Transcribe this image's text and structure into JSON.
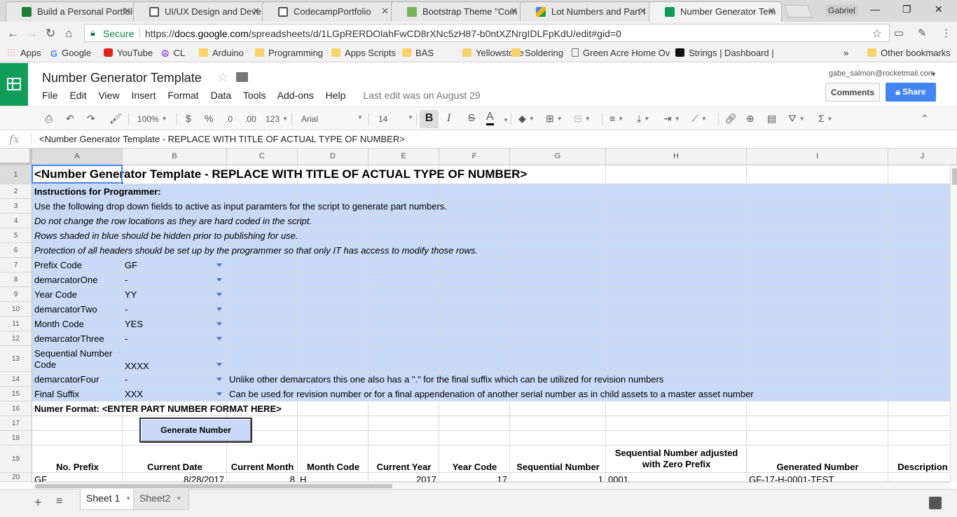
{
  "browser": {
    "tabs": [
      {
        "label": "Build a Personal Portfoli",
        "color": "#1e7e34",
        "active": false
      },
      {
        "label": "UI/UX Design and Deve",
        "color": "#555555",
        "active": false
      },
      {
        "label": "CodecampPortfolio",
        "color": "#555555",
        "active": false
      },
      {
        "label": "Bootstrap Theme \"Com",
        "color": "#76b55b",
        "active": false
      },
      {
        "label": "Lot Numbers and Part I",
        "color": "#f4b400",
        "active": false
      },
      {
        "label": "Number Generator Tem",
        "color": "#0f9d58",
        "active": true
      }
    ],
    "profile": "Gabriel",
    "secure_label": "Secure",
    "url_scheme": "https://",
    "url_host": "docs.google.com",
    "url_path": "/spreadsheets/d/1LGpRERDOlahFwCD8rXNc5zH87-b0ntXZNrgIDLFpKdU/edit#gid=0",
    "bookmarks": [
      {
        "label": "Apps",
        "icon": "apps-grid-icon"
      },
      {
        "label": "Google",
        "icon": "google-icon"
      },
      {
        "label": "YouTube",
        "icon": "youtube-icon"
      },
      {
        "label": "CL",
        "icon": "peace-icon"
      },
      {
        "label": "Arduino",
        "icon": "folder-icon"
      },
      {
        "label": "Programming",
        "icon": "folder-icon"
      },
      {
        "label": "Apps Scripts",
        "icon": "folder-icon"
      },
      {
        "label": "BAS",
        "icon": "folder-icon"
      },
      {
        "label": "Yellowstone",
        "icon": "folder-icon"
      },
      {
        "label": "Soldering",
        "icon": "folder-icon"
      },
      {
        "label": "Green Acre Home Ov",
        "icon": "page-icon"
      },
      {
        "label": "Strings | Dashboard |",
        "icon": "strings-icon"
      }
    ],
    "bookmarks_more": "»",
    "other_bookmarks": "Other bookmarks"
  },
  "doc": {
    "title": "Number Generator Template",
    "menus": [
      "File",
      "Edit",
      "View",
      "Insert",
      "Format",
      "Data",
      "Tools",
      "Add-ons",
      "Help"
    ],
    "last_edit": "Last edit was on August 29",
    "account": "gabe_salmon@rocketmail.com",
    "comments_label": "Comments",
    "share_label": "Share"
  },
  "toolbar": {
    "zoom": "100%",
    "currency": "$",
    "percent": "%",
    "dec_decrease": ".0",
    "dec_increase": ".00",
    "more_formats": "123",
    "font": "Arial",
    "font_size": "14",
    "bold": "B",
    "italic": "I",
    "strike": "S",
    "text_color": "A"
  },
  "formula_bar": {
    "fx": "fx",
    "content": "<Number Generator Template - REPLACE WITH TITLE OF ACTUAL TYPE OF NUMBER>"
  },
  "grid": {
    "columns": [
      "A",
      "B",
      "C",
      "D",
      "E",
      "F",
      "G",
      "H",
      "I",
      "J"
    ],
    "rows": [
      "1",
      "2",
      "3",
      "4",
      "5",
      "6",
      "7",
      "8",
      "9",
      "10",
      "11",
      "12",
      "13",
      "14",
      "15",
      "16",
      "17",
      "18",
      "19",
      "20"
    ],
    "title": "<Number Generator Template - REPLACE WITH TITLE OF ACTUAL TYPE OF NUMBER>",
    "instructions_header": "Instructions for Programmer:",
    "instructions": [
      "Use the following drop down fields to active as input paramters for the script to generate part numbers.",
      "Do not change the row locations as they are hard coded in the script.",
      "Rows shaded in blue should be hidden prior to publishing for use.",
      "Protection of all headers should be set up by the programmer so that only IT has access to modify those rows."
    ],
    "params": [
      {
        "label": "Prefix Code",
        "value": "GF"
      },
      {
        "label": "demarcatorOne",
        "value": "-"
      },
      {
        "label": "Year Code",
        "value": "YY"
      },
      {
        "label": "demarcatorTwo",
        "value": "-"
      },
      {
        "label": "Month Code",
        "value": "YES"
      },
      {
        "label": "demarcatorThree",
        "value": "-"
      },
      {
        "label": "Sequential Number Code",
        "value": "XXXX"
      },
      {
        "label": "demarcatorFour",
        "value": "-",
        "note": "Unlike other demarcators this one also has a \".\" for the final suffix which can be utilized for revision numbers"
      },
      {
        "label": "Final Suffix",
        "value": "XXX",
        "note": "Can be used for revision number or for a final appendenation of another serial number as in child assets to a master asset number"
      }
    ],
    "format_line": "Numer Format:  <ENTER PART NUMBER FORMAT HERE>",
    "generate_label": "Generate Number",
    "table_headers": [
      "No. Prefix",
      "Current Date",
      "Current Month",
      "Month Code",
      "Current Year",
      "Year Code",
      "Sequential Number",
      "Sequential Number adjusted with Zero Prefix",
      "Generated Number",
      "Description"
    ],
    "row20": [
      "GF",
      "8/28/2017",
      "8",
      "H",
      "2017",
      "17",
      "1",
      "0001",
      "GF-17-H-0001-TEST",
      ""
    ]
  },
  "sheets": {
    "tabs": [
      {
        "label": "Sheet 1",
        "active": true
      },
      {
        "label": "Sheet2",
        "active": false
      }
    ]
  }
}
